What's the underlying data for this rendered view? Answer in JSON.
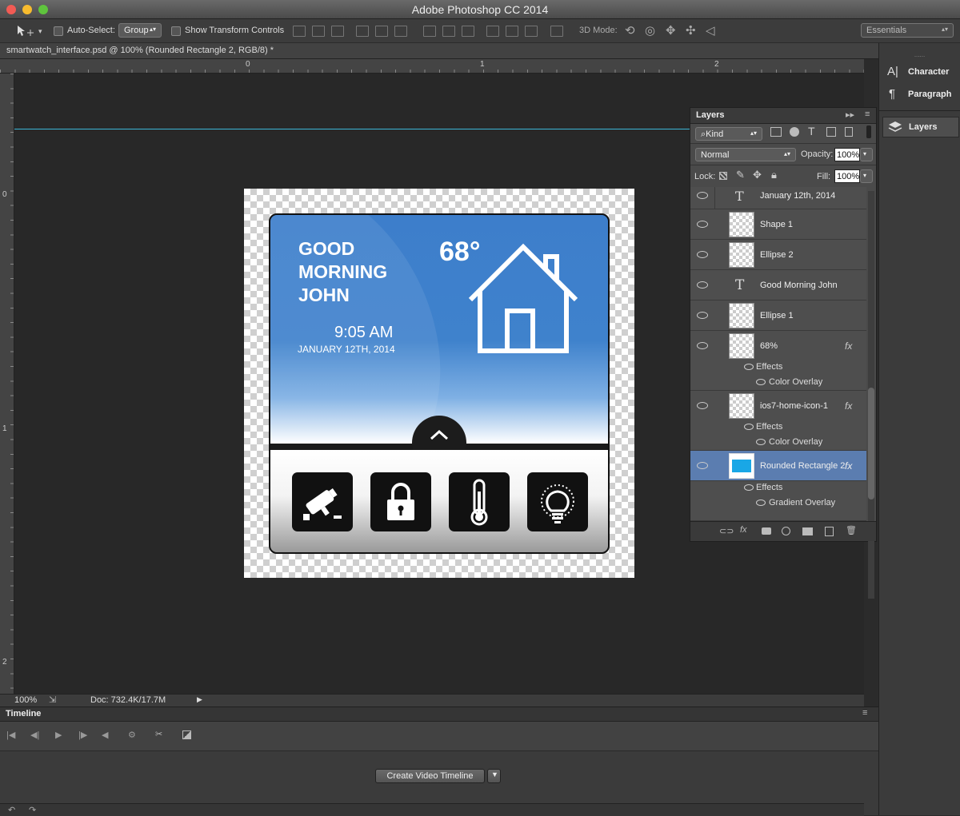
{
  "app_title": "Adobe Photoshop CC 2014",
  "options": {
    "auto_select_label": "Auto-Select:",
    "auto_select_value": "Group",
    "show_transform_label": "Show Transform Controls",
    "mode3d_label": "3D Mode:",
    "workspace": "Essentials"
  },
  "doc_tab": "smartwatch_interface.psd @ 100% (Rounded Rectangle 2, RGB/8) *",
  "ruler": {
    "h0": "0",
    "h1": "1",
    "h2": "2",
    "v0": "0",
    "v1": "1",
    "v2": "2"
  },
  "watch": {
    "greeting": "GOOD MORNING JOHN",
    "temperature": "68°",
    "time": "9:05 AM",
    "date": "JANUARY 12TH, 2014",
    "apps": [
      "camera-icon",
      "lock-icon",
      "thermometer-icon",
      "lightbulb-icon"
    ]
  },
  "dock": {
    "character": "Character",
    "paragraph": "Paragraph",
    "layers": "Layers"
  },
  "layers_panel": {
    "title": "Layers",
    "kind": "Kind",
    "blend_mode": "Normal",
    "opacity_label": "Opacity:",
    "opacity_value": "100%",
    "lock_label": "Lock:",
    "fill_label": "Fill:",
    "fill_value": "100%",
    "layers": [
      {
        "name": "January 12th, 2014",
        "type": "text"
      },
      {
        "name": "Shape 1",
        "type": "shape"
      },
      {
        "name": "Ellipse 2",
        "type": "shape"
      },
      {
        "name": "Good Morning John",
        "type": "text"
      },
      {
        "name": "Ellipse 1",
        "type": "shape"
      },
      {
        "name": "68%",
        "type": "shape",
        "fx": "fx",
        "effects": "Effects",
        "effect": "Color Overlay"
      },
      {
        "name": "ios7-home-icon-1",
        "type": "shape",
        "fx": "fx",
        "effects": "Effects",
        "effect": "Color Overlay"
      },
      {
        "name": "Rounded Rectangle 2",
        "type": "shape",
        "fx": "fx",
        "effects": "Effects",
        "effect": "Gradient Overlay",
        "selected": true
      }
    ]
  },
  "status": {
    "zoom": "100%",
    "doc": "Doc: 732.4K/17.7M"
  },
  "timeline": {
    "title": "Timeline",
    "create_button": "Create Video Timeline"
  },
  "colors": {
    "screen_blue": "#3f82cc",
    "guide": "#3bb6d6",
    "selected_layer": "#5b7db0",
    "thumb_blue": "#19a7e6"
  }
}
